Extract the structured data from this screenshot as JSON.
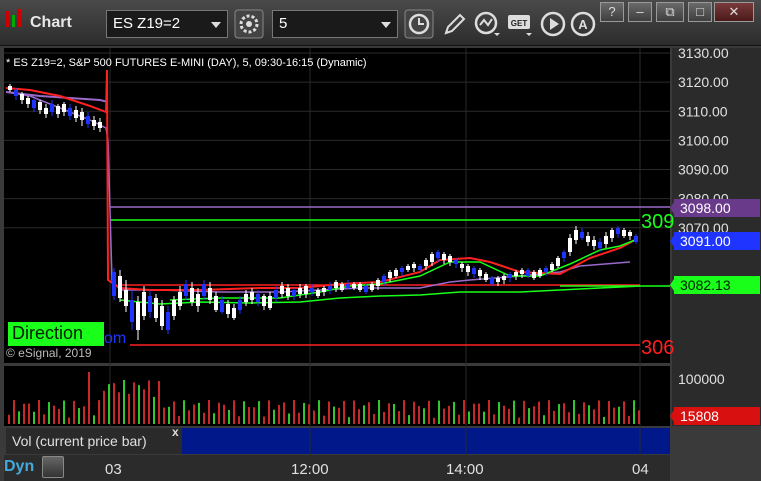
{
  "window": {
    "title": "Chart",
    "symbol": "ES Z19=2",
    "interval": "5",
    "min_btn": "–",
    "max_btn": "□",
    "close_btn": "✕"
  },
  "chart": {
    "header": "* ES Z19=2, S&P 500 FUTURES E-MINI (DAY), 5, 09:30-16:15 (Dynamic)",
    "copyright": "© eSignal, 2019",
    "direction_label": "Direction",
    "partial_text": "om",
    "price_axis": [
      "3130.00",
      "3120.00",
      "3110.00",
      "3100.00",
      "3090.00",
      "3080.00",
      "3070.00"
    ],
    "line_labels": {
      "green": "309",
      "red": "306"
    },
    "badges": {
      "purple": "3098.00",
      "blue": "3091.00",
      "green": "3082.13",
      "vol_red": "15808"
    },
    "vol_axis": "100000",
    "vol_label": "Vol (current price bar)",
    "vol_close": "x",
    "time_axis": [
      "03",
      "12:00",
      "14:00",
      "04"
    ],
    "dyn_label": "Dyn",
    "colors": {
      "bg": "#000000",
      "grid": "#2a2a2a",
      "up": "#ffffff",
      "down": "#1f35ff",
      "red": "#ff2020",
      "green": "#19ff19",
      "purple": "#9a6ac8",
      "axis_bg": "#2b2b2b"
    }
  }
}
